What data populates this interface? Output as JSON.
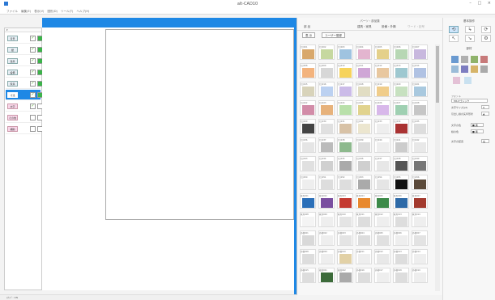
{
  "window": {
    "title": "alt-CAD10",
    "controls": "– □ ×"
  },
  "menu": [
    "ファイル",
    "編集(E)",
    "表示(V)",
    "図形(D)",
    "ツール(T)",
    "ヘルプ(H)"
  ],
  "layers": [
    {
      "label": "背景",
      "selected": false,
      "visible": true,
      "locked": true
    },
    {
      "label": "壁",
      "selected": false,
      "visible": true,
      "locked": true
    },
    {
      "label": "建具",
      "selected": false,
      "visible": true,
      "locked": true
    },
    {
      "label": "設備",
      "selected": false,
      "visible": true,
      "locked": true
    },
    {
      "label": "家具",
      "selected": false,
      "visible": true,
      "locked": true
    },
    {
      "label": "寸法",
      "selected": true,
      "visible": true,
      "locked": true
    },
    {
      "label": "文字",
      "selected": false,
      "visible": true,
      "locked": false
    },
    {
      "label": "その他",
      "selected": false,
      "visible": false,
      "locked": false
    },
    {
      "label": "補助",
      "selected": false,
      "visible": false,
      "locked": false
    }
  ],
  "library": {
    "title": "パーツ・部品集",
    "tabs": [
      "部 品",
      "建具・家具",
      "設備・外構",
      "ワード・記号"
    ],
    "buttons": [
      "表 示",
      "ユーザー登録"
    ]
  },
  "tiles": [
    {
      "label": "ｸﾛｽ001",
      "color": "#d8a86c"
    },
    {
      "label": "ｸﾛｽ002",
      "color": "#c6d8a0"
    },
    {
      "label": "ｸﾛｽ003",
      "color": "#9fc3e0"
    },
    {
      "label": "ｸﾛｽ004",
      "color": "#e3b5cf"
    },
    {
      "label": "ｸﾛｽ005",
      "color": "#e4d08a"
    },
    {
      "label": "ｸﾛｽ006",
      "color": "#b7d7b4"
    },
    {
      "label": "ｸﾛｽ007",
      "color": "#c8b8de"
    },
    {
      "label": "ｸﾛｽ008",
      "color": "#f3b37d"
    },
    {
      "label": "ｸﾛｽ009",
      "color": "#d7d7d7"
    },
    {
      "label": "ｸﾛｽ010",
      "color": "#f6d35b"
    },
    {
      "label": "ｸﾛｽ011",
      "color": "#cfa6d6"
    },
    {
      "label": "ｸﾛｽ012",
      "color": "#e8c79f"
    },
    {
      "label": "ｸﾛｽ013",
      "color": "#9ec8d0"
    },
    {
      "label": "ｸﾛｽ014",
      "color": "#b0c2e3"
    },
    {
      "label": "ｸﾛｽ015",
      "color": "#d8d3ba"
    },
    {
      "label": "ｸﾛｽ016",
      "color": "#bcd1f1"
    },
    {
      "label": "ｸﾛｽ017",
      "color": "#cbbbe8"
    },
    {
      "label": "ｸﾛｽ018",
      "color": "#e1ddc3"
    },
    {
      "label": "ｸﾛｽ019",
      "color": "#f0cd8b"
    },
    {
      "label": "ｸﾛｽ020",
      "color": "#c7e1c0"
    },
    {
      "label": "ｸﾛｽ021",
      "color": "#a9c9df"
    },
    {
      "label": "ｸﾛｽ022",
      "color": "#d28ca8"
    },
    {
      "label": "ｸﾛｽ023",
      "color": "#e7b27b"
    },
    {
      "label": "ｸﾛｽ024",
      "color": "#b9e0aa"
    },
    {
      "label": "ｸﾛｽ025",
      "color": "#e1d38e"
    },
    {
      "label": "ｸﾛｽ026",
      "color": "#d8b8ea"
    },
    {
      "label": "ｸﾛｽ027",
      "color": "#9fd0b2"
    },
    {
      "label": "ｸﾛｽ028",
      "color": "#c6c6c6"
    },
    {
      "label": "ｸﾛｽ029",
      "color": "#444"
    },
    {
      "label": "ｸﾛｽ030",
      "color": "#e0e0e0"
    },
    {
      "label": "ｸﾛｽ031",
      "color": "#d8c2a6"
    },
    {
      "label": "ｸﾛｽ032",
      "color": "#ece6cf"
    },
    {
      "label": "ｸﾛｽ033",
      "color": "#eee"
    },
    {
      "label": "ｸﾛｽ034",
      "color": "#a33"
    },
    {
      "label": "ｸﾛｽ035",
      "color": "#ddd"
    },
    {
      "label": "ｸﾛｽ036",
      "color": "#e5e5e5"
    },
    {
      "label": "ｸﾛｽ037",
      "color": "#bbb"
    },
    {
      "label": "ｸﾛｽ038",
      "color": "#8db98d"
    },
    {
      "label": "ｸﾛｽ039",
      "color": "#ddd"
    },
    {
      "label": "ｸﾛｽ040",
      "color": "#eee"
    },
    {
      "label": "ｸﾛｽ041",
      "color": "#ccc"
    },
    {
      "label": "ｸﾛｽ042",
      "color": "#e8e8e8"
    },
    {
      "label": "ｸﾛｽ043",
      "color": "#e0e0e0"
    },
    {
      "label": "ｸﾛｽ044",
      "color": "#d0d0d0"
    },
    {
      "label": "ｸﾛｽ045",
      "color": "#aaa"
    },
    {
      "label": "ｸﾛｽ046",
      "color": "#cfcfcf"
    },
    {
      "label": "ｸﾛｽ047",
      "color": "#e7e7e7"
    },
    {
      "label": "ｸﾛｽ048",
      "color": "#555"
    },
    {
      "label": "ｸﾛｽ049",
      "color": "#777"
    },
    {
      "label": "ｸﾛｽ050",
      "color": "#eee"
    },
    {
      "label": "ｸﾛｽ051",
      "color": "#ddd"
    },
    {
      "label": "ｸﾛｽ052",
      "color": "#ddd"
    },
    {
      "label": "ｸﾛｽ053",
      "color": "#aaa"
    },
    {
      "label": "ｸﾛｽ054",
      "color": "#e5e5e5"
    },
    {
      "label": "ｸﾛｽ055",
      "color": "#111"
    },
    {
      "label": "ｸﾛｽ056",
      "color": "#5b4a3a"
    },
    {
      "label": "家具001",
      "color": "#2b6fb8"
    },
    {
      "label": "家具002",
      "color": "#7a4fa0"
    },
    {
      "label": "家具003",
      "color": "#c43a31"
    },
    {
      "label": "家具004",
      "color": "#e8892e"
    },
    {
      "label": "家具005",
      "color": "#3d8a49"
    },
    {
      "label": "家具006",
      "color": "#2e6aa7"
    },
    {
      "label": "家具007",
      "color": "#a33a2e"
    },
    {
      "label": "家具008",
      "color": "#f4f4f4"
    },
    {
      "label": "家具009",
      "color": "#eee"
    },
    {
      "label": "家具010",
      "color": "#e4e4e4"
    },
    {
      "label": "家具011",
      "color": "#ddd"
    },
    {
      "label": "家具012",
      "color": "#eee"
    },
    {
      "label": "家具013",
      "color": "#ddd"
    },
    {
      "label": "家具014",
      "color": "#eee"
    },
    {
      "label": "外構001",
      "color": "#d9d9d9"
    },
    {
      "label": "外構002",
      "color": "#eee"
    },
    {
      "label": "外構003",
      "color": "#e4e4e4"
    },
    {
      "label": "外構004",
      "color": "#ddd"
    },
    {
      "label": "外構005",
      "color": "#e0e0e0"
    },
    {
      "label": "外構006",
      "color": "#eee"
    },
    {
      "label": "外構007",
      "color": "#e3e3e3"
    },
    {
      "label": "外構008",
      "color": "#ddd"
    },
    {
      "label": "外構009",
      "color": "#eee"
    },
    {
      "label": "外構010",
      "color": "#e2d1a6"
    },
    {
      "label": "外構011",
      "color": "#eee"
    },
    {
      "label": "外構012",
      "color": "#e8e8e8"
    },
    {
      "label": "外構013",
      "color": "#ddd"
    },
    {
      "label": "外構014",
      "color": "#eee"
    },
    {
      "label": "外構015",
      "color": "#ddd"
    },
    {
      "label": "植栽001",
      "color": "#3c6b3a"
    },
    {
      "label": "植栽002",
      "color": "#aaa"
    },
    {
      "label": "外構016",
      "color": "#ddd"
    },
    {
      "label": "外構017",
      "color": "#eee"
    },
    {
      "label": "外構018",
      "color": "#ddd"
    },
    {
      "label": "外構019",
      "color": "#eee"
    }
  ],
  "right": {
    "title": "基本操作",
    "tools": [
      "⟲",
      "↳",
      "⟳",
      "↖",
      "↘",
      "⚙"
    ],
    "section": "部材",
    "props": [
      {
        "label": "フォント",
        "value": "MS Pゴシック"
      },
      {
        "label": "文字サイズ(pt)",
        "value": "9"
      },
      {
        "label": "引出し線の矢印形状",
        "value": "▲"
      },
      {
        "label": "文字の色",
        "value": "■ 黒"
      },
      {
        "label": "線の色",
        "value": "■ 黒"
      },
      {
        "label": "文字の配置",
        "value": "左"
      }
    ]
  },
  "status": "ｽﾅｯﾌﾟ: ON",
  "colors": {
    "accent": "#1e88e5",
    "check": "#3cb34a"
  }
}
